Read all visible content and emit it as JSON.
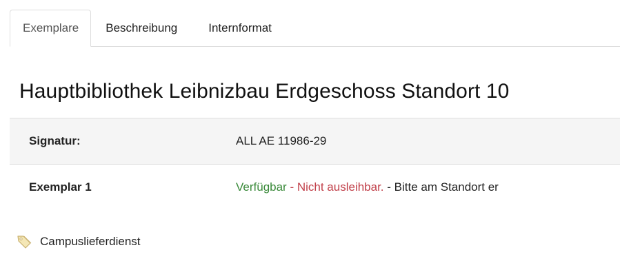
{
  "tabs": [
    {
      "label": "Exemplare",
      "active": true
    },
    {
      "label": "Beschreibung",
      "active": false
    },
    {
      "label": "Internformat",
      "active": false
    }
  ],
  "location": {
    "title": "Hauptbibliothek Leibnizbau Erdgeschoss Standort 10"
  },
  "holdings": {
    "signature_label": "Signatur:",
    "signature_value": "ALL AE 11986-29",
    "copy_label": "Exemplar 1",
    "status_available": "Verfügbar",
    "status_separator": " - ",
    "status_loan": "Nicht ausleihbar.",
    "status_note": " - Bitte am Standort er"
  },
  "links": {
    "campus_delivery": "Campuslieferdienst"
  },
  "colors": {
    "available": "#3a8a3a",
    "not_loanable": "#c1404a",
    "border": "#dddddd"
  },
  "icons": {
    "campus_delivery": "tag-icon"
  }
}
